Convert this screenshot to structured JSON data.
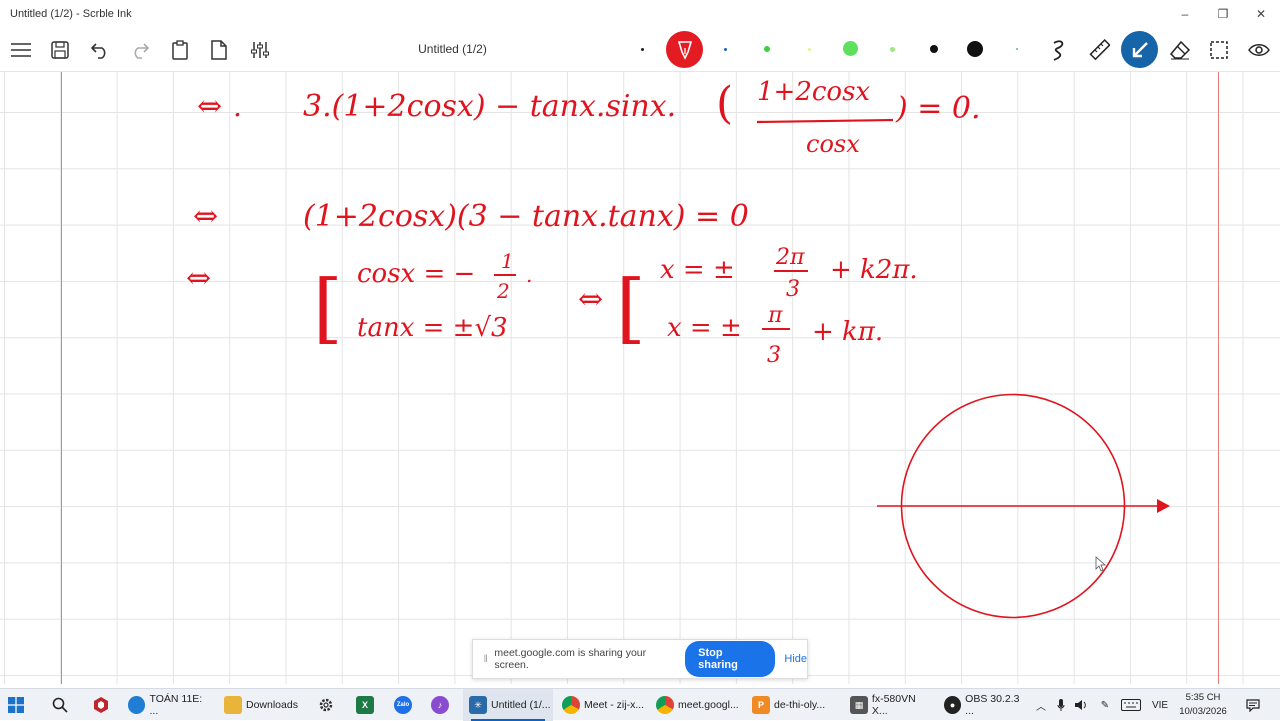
{
  "window": {
    "title": "Untitled (1/2) - Scrble Ink",
    "minimize": "–",
    "maximize": "❐",
    "close": "✕"
  },
  "toolbar": {
    "doc_title": "Untitled (1/2)",
    "buttons": [
      "menu-icon",
      "save-icon",
      "undo-icon",
      "redo-icon",
      "paste-icon",
      "new-page-icon",
      "settings-sliders-icon"
    ],
    "active_pen_color": "#e31b23",
    "tools": [
      "lasso-icon",
      "ruler-icon",
      "select-pen-icon",
      "eraser-icon",
      "crop-select-icon",
      "view-eye-icon"
    ]
  },
  "canvas": {
    "ink_color": "#e0141e",
    "line1": {
      "arrow": "⇔",
      "left": "3.(1+2cosx) − tanx.sinx.",
      "num": "1+2cosx",
      "den": "cosx",
      "right": ") = 0."
    },
    "line2": {
      "arrow": "⇔",
      "text": "(1+2cosx)(3 − tanx.tanx) = 0"
    },
    "line3": {
      "arrow": "⇔",
      "case1": "cosx = −",
      "case1_num": "1",
      "case1_den": "2",
      "case2": "tanx = ±√3",
      "arrow2": "⇔",
      "sol1_pre": "x = ±",
      "sol1_num": "2π",
      "sol1_den": "3",
      "sol1_post": "+ k2π.",
      "sol2_pre": "x = ±",
      "sol2_num": "π",
      "sol2_den": "3",
      "sol2_post": "+ kπ."
    }
  },
  "share_banner": {
    "message": "meet.google.com is sharing your screen.",
    "stop_label": "Stop sharing",
    "hide_label": "Hide"
  },
  "taskbar": {
    "items": [
      {
        "label": "TOÁN 11E: ...",
        "icon": "edge-icon",
        "color": "#1f7ed4"
      },
      {
        "label": "Downloads",
        "icon": "folder-icon",
        "color": "#e8b53a"
      },
      {
        "label": "Untitled (1/...",
        "icon": "scrble-icon",
        "color": "#2b6aa8"
      },
      {
        "label": "Meet - zij-x...",
        "icon": "chrome-icon",
        "color": "#d33"
      },
      {
        "label": "meet.googl...",
        "icon": "chrome-icon",
        "color": "#d33"
      },
      {
        "label": "de-thi-oly...",
        "icon": "pdf-icon",
        "color": "#f08a24"
      },
      {
        "label": "fx-580VN X...",
        "icon": "calculator-icon",
        "color": "#555"
      },
      {
        "label": "OBS 30.2.3 ...",
        "icon": "obs-icon",
        "color": "#222"
      }
    ],
    "language": "VIE",
    "time": "5:35 CH",
    "date": "10/03/2026"
  }
}
